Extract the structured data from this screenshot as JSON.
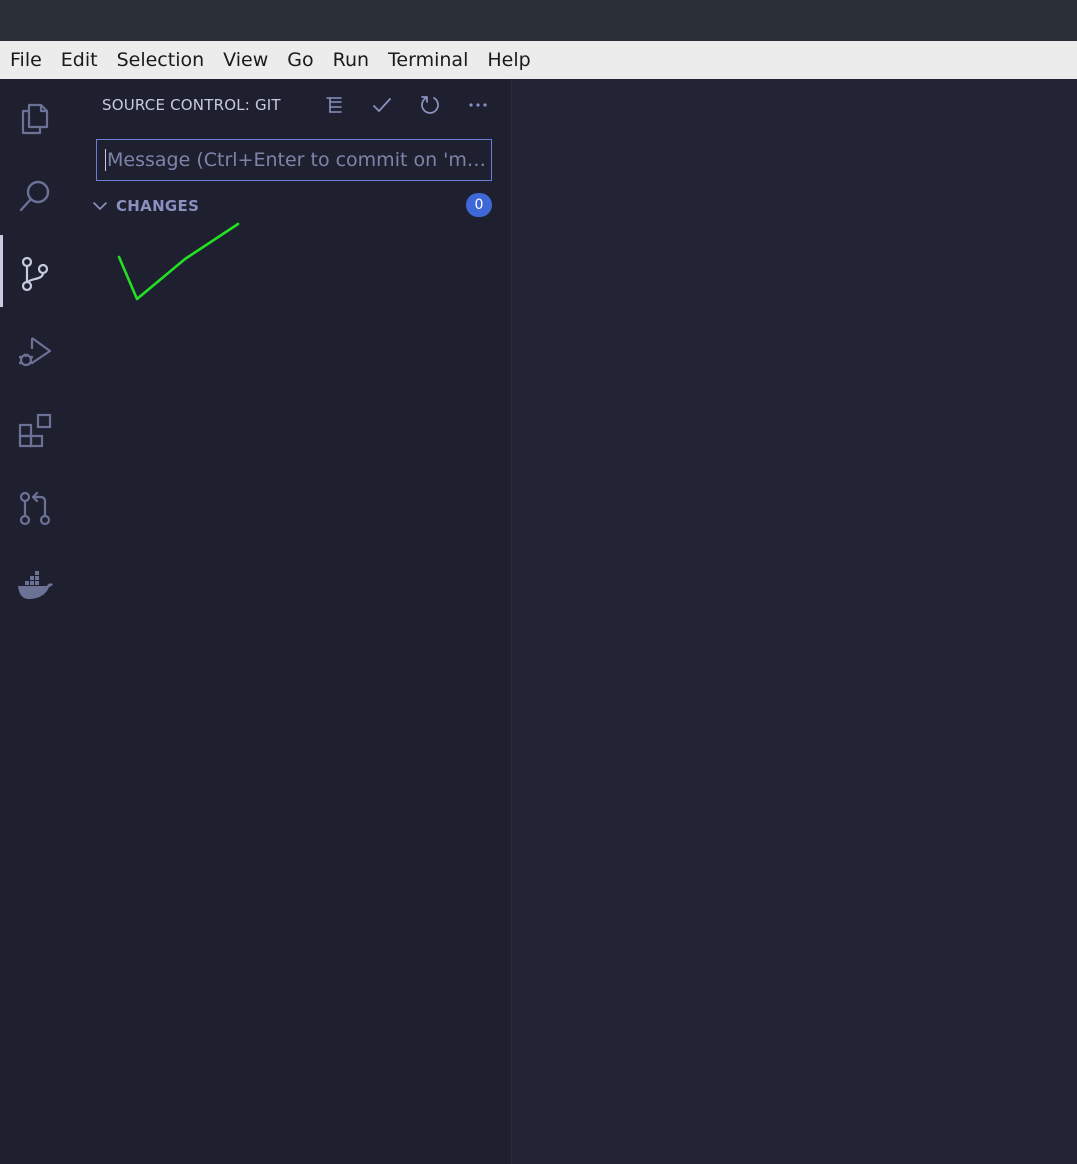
{
  "menubar": {
    "items": [
      "File",
      "Edit",
      "Selection",
      "View",
      "Go",
      "Run",
      "Terminal",
      "Help"
    ]
  },
  "activitybar": {
    "icons": [
      "explorer-icon",
      "search-icon",
      "source-control-icon",
      "run-debug-icon",
      "extensions-icon",
      "pull-request-icon",
      "docker-icon"
    ],
    "active": "source-control-icon"
  },
  "source_control": {
    "title": "SOURCE CONTROL: GIT",
    "actions": [
      "view-as-tree-icon",
      "commit-check-icon",
      "refresh-icon",
      "more-actions-icon"
    ],
    "commit_placeholder": "Message (Ctrl+Enter to commit on 'mast…",
    "changes": {
      "label": "CHANGES",
      "count": "0"
    }
  },
  "colors": {
    "background": "#1e2030",
    "editor": "#222436",
    "accent": "#3e68d7",
    "annotation_stroke": "#22e022"
  }
}
